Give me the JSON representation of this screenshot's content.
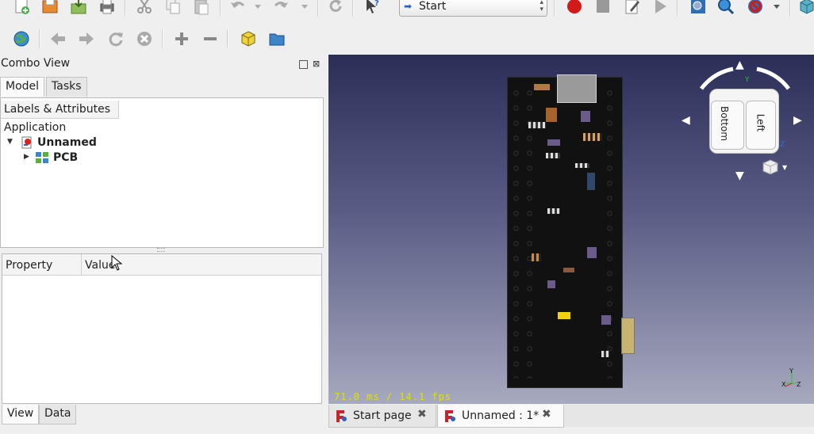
{
  "toolbar": {
    "workbench_label": "Start"
  },
  "combo_view": {
    "title": "Combo View",
    "tabs": [
      "Model",
      "Tasks"
    ],
    "tree_header": "Labels & Attributes",
    "tree": {
      "root": "Application",
      "document": "Unnamed",
      "child": "PCB"
    },
    "property_header": [
      "Property",
      "Value"
    ],
    "bottom_tabs": [
      "View",
      "Data"
    ]
  },
  "viewport": {
    "fps_text": "71.0 ms / 14.1 fps",
    "navcube": {
      "face_front": "Bottom",
      "face_side": "Left"
    },
    "axis_labels": [
      "Y",
      "Z",
      "X"
    ]
  },
  "doc_tabs": [
    {
      "label": "Start page"
    },
    {
      "label": "Unnamed : 1*"
    }
  ],
  "colors": {
    "viewport_top": "#2b2e58",
    "viewport_bottom": "#a7a9bf",
    "pcb": "#111111",
    "fps_text": "#e0e000",
    "record": "#d11a1a"
  }
}
